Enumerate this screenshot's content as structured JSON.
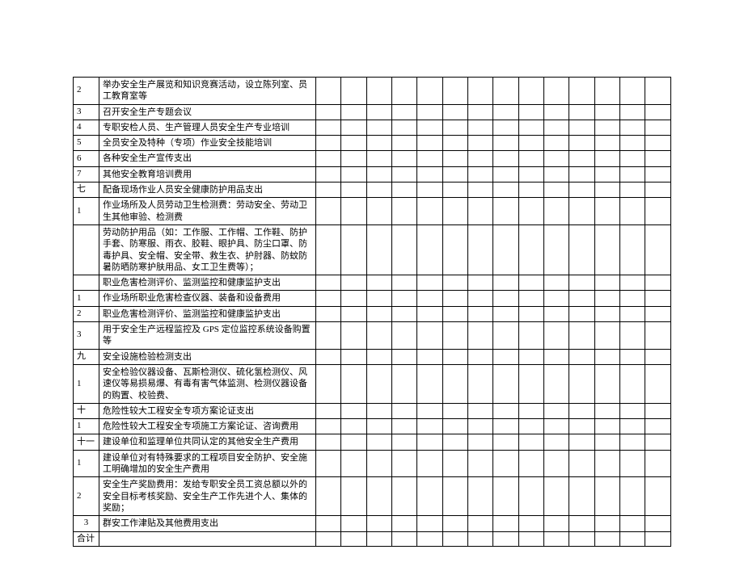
{
  "rows": [
    {
      "num": "2",
      "desc": "举办安全生产展览和知识竞赛活动，设立陈列室、员工教育室等"
    },
    {
      "num": "3",
      "desc": "召开安全生产专题会议"
    },
    {
      "num": "4",
      "desc": "专职安检人员、生产管理人员安全生产专业培训"
    },
    {
      "num": "5",
      "desc": "全员安全及特种（专项）作业安全技能培训"
    },
    {
      "num": "6",
      "desc": "各种安全生产宣传支出"
    },
    {
      "num": "7",
      "desc": "其他安全教育培训费用"
    },
    {
      "num": "七",
      "desc": "配备现场作业人员安全健康防护用品支出"
    },
    {
      "num": "1",
      "desc": "作业场所及人员劳动卫生检测费：劳动安全、劳动卫生其他审验、检测费"
    },
    {
      "num": "",
      "desc": "劳动防护用品（如：工作服、工作帽、工作鞋、防护手套、防寒服、雨衣、胶鞋、眼护具、防尘口罩、防毒护具、安全帽、安全带、救生衣、护肘器、防蚊防暑防晒防寒护肤用品、女工卫生费等）；"
    },
    {
      "num": "",
      "desc": "职业危害检测评价、监测监控和健康监护支出"
    },
    {
      "num": "1",
      "desc": "作业场所职业危害检查仪器、装备和设备费用"
    },
    {
      "num": "2",
      "desc": "职业危害检测评价、监测监控和健康监护支出"
    },
    {
      "num": "3",
      "desc": "用于安全生产远程监控及 GPS 定位监控系统设备购置等"
    },
    {
      "num": "九",
      "desc": "安全设施检验检测支出"
    },
    {
      "num": "1",
      "desc": "安全检验仪器设备、瓦斯检测仪、硫化氢检测仪、风速仪等易损易爆、有毒有害气体监测、检测仪器设备的购置、校验费、"
    },
    {
      "num": "十",
      "desc": "危险性较大工程安全专项方案论证支出"
    },
    {
      "num": "1",
      "desc": "危险性较大工程安全专项施工方案论证、咨询费用"
    },
    {
      "num": "十一",
      "desc": "建设单位和监理单位共同认定的其他安全生产费用"
    },
    {
      "num": "1",
      "desc": "建设单位对有特殊要求的工程项目安全防护、安全施工明确增加的安全生产费用"
    },
    {
      "num": "2",
      "desc": "安全生产奖励费用：发给专职安全员工资总额以外的安全目标考核奖励、安全生产工作先进个人、集体的奖励；"
    },
    {
      "num": "3",
      "desc": "群安工作津贴及其他费用支出",
      "numCenter": true
    },
    {
      "num": "合计",
      "desc": ""
    }
  ]
}
